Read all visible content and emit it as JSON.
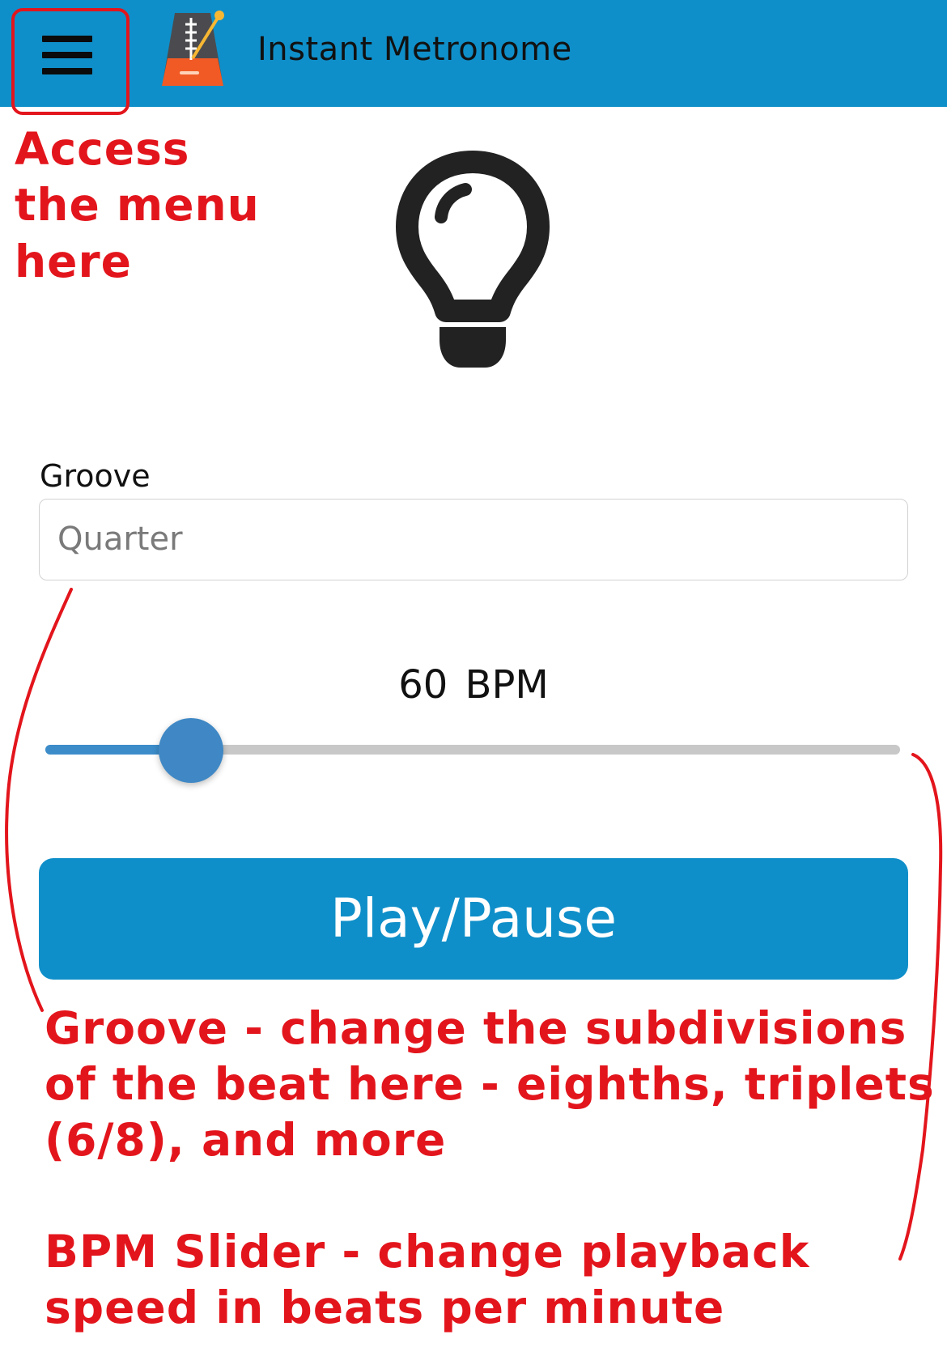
{
  "header": {
    "title": "Instant Metronome",
    "menu_icon": "hamburger-menu-icon",
    "logo_icon": "metronome-logo-icon",
    "background": "#0f8fc9"
  },
  "main": {
    "indicator_icon": "lightbulb-icon",
    "groove": {
      "label": "Groove",
      "value": "Quarter"
    },
    "bpm": {
      "value": 60,
      "display": "60 BPM",
      "fill_fraction": 0.17
    },
    "play_button_label": "Play/Pause",
    "accent_color": "#0f8fc9"
  },
  "annotations": {
    "menu": "Access the menu here",
    "groove": "Groove - change the subdivisions of the beat here - eighths, triplets (6/8), and more",
    "bpm": "BPM Slider - change playback speed in beats per minute",
    "color": "#e3151c"
  }
}
